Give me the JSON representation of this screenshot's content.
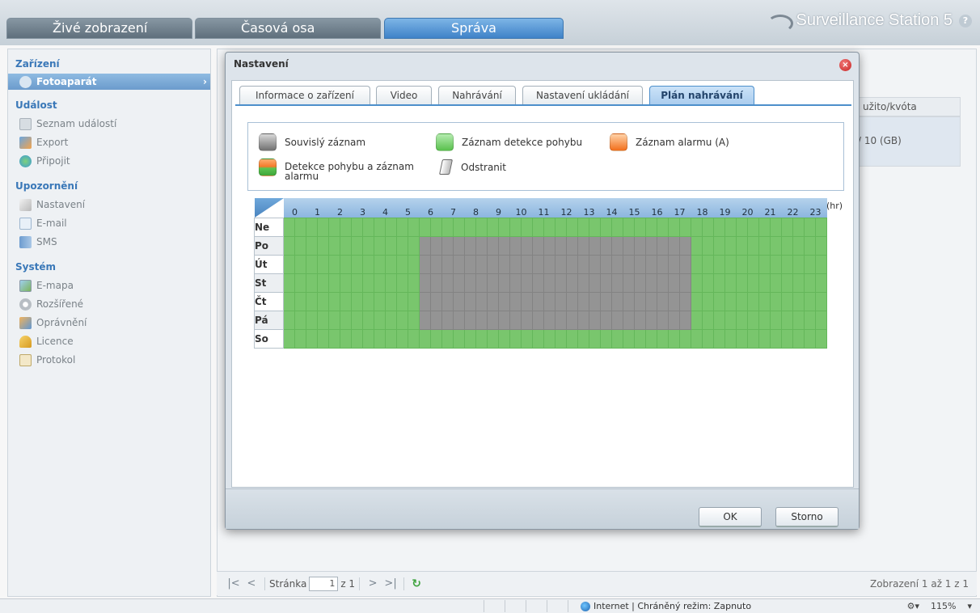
{
  "top_tabs": [
    "Živé zobrazení",
    "Časová osa",
    "Správa"
  ],
  "brand": "Surveillance Station 5",
  "sidebar": {
    "sections": [
      {
        "title": "Zařízení",
        "items": [
          {
            "label": "Fotoaparát",
            "icon": "camera-icon",
            "selected": true
          }
        ]
      },
      {
        "title": "Událost",
        "items": [
          {
            "label": "Seznam událostí",
            "icon": "event-list-icon"
          },
          {
            "label": "Export",
            "icon": "export-icon"
          },
          {
            "label": "Připojit",
            "icon": "mount-icon"
          }
        ]
      },
      {
        "title": "Upozornění",
        "items": [
          {
            "label": "Nastavení",
            "icon": "wrench-icon"
          },
          {
            "label": "E-mail",
            "icon": "email-icon"
          },
          {
            "label": "SMS",
            "icon": "sms-icon"
          }
        ]
      },
      {
        "title": "Systém",
        "items": [
          {
            "label": "E-mapa",
            "icon": "emap-icon"
          },
          {
            "label": "Rozšířené",
            "icon": "gear-icon"
          },
          {
            "label": "Oprávnění",
            "icon": "permission-icon"
          },
          {
            "label": "Licence",
            "icon": "key-icon"
          },
          {
            "label": "Protokol",
            "icon": "log-icon"
          }
        ]
      }
    ]
  },
  "background_grid": {
    "column_header": "užito/kvóta",
    "cell": "/ 10 (GB)"
  },
  "pager": {
    "page_label": "Stránka",
    "page_value": "1",
    "of_label": "z 1",
    "info": "Zobrazení 1 až 1 z 1"
  },
  "statusbar": {
    "zone": "Internet | Chráněný režim: Zapnuto",
    "zoom": "115%"
  },
  "dialog": {
    "title": "Nastavení",
    "tabs": [
      "Informace o zařízení",
      "Video",
      "Nahrávání",
      "Nastavení ukládání",
      "Plán nahrávání"
    ],
    "active_tab": 4,
    "legend": [
      {
        "label": "Souvislý záznam",
        "swatch": "grey"
      },
      {
        "label": "Záznam detekce pohybu",
        "swatch": "green"
      },
      {
        "label": "Záznam alarmu (A)",
        "swatch": "orange"
      },
      {
        "label": "Detekce pohybu a záznam alarmu",
        "swatch": "green-orange"
      },
      {
        "label": "Odstranit",
        "swatch": "eraser"
      }
    ],
    "schedule": {
      "hours": [
        "0",
        "1",
        "2",
        "3",
        "4",
        "5",
        "6",
        "7",
        "8",
        "9",
        "10",
        "11",
        "12",
        "13",
        "14",
        "15",
        "16",
        "17",
        "18",
        "19",
        "20",
        "21",
        "22",
        "23"
      ],
      "hour_unit": "(hr)",
      "days": [
        "Ne",
        "Po",
        "Út",
        "St",
        "Čt",
        "Pá",
        "So"
      ],
      "continuous_days": [
        1,
        2,
        3,
        4,
        5
      ],
      "continuous_from_hour": 6,
      "continuous_to_hour": 18
    },
    "ok_label": "OK",
    "cancel_label": "Storno"
  },
  "colors": {
    "motion": "#79c66d",
    "continuous": "#949494",
    "accent": "#4d8fcb"
  }
}
